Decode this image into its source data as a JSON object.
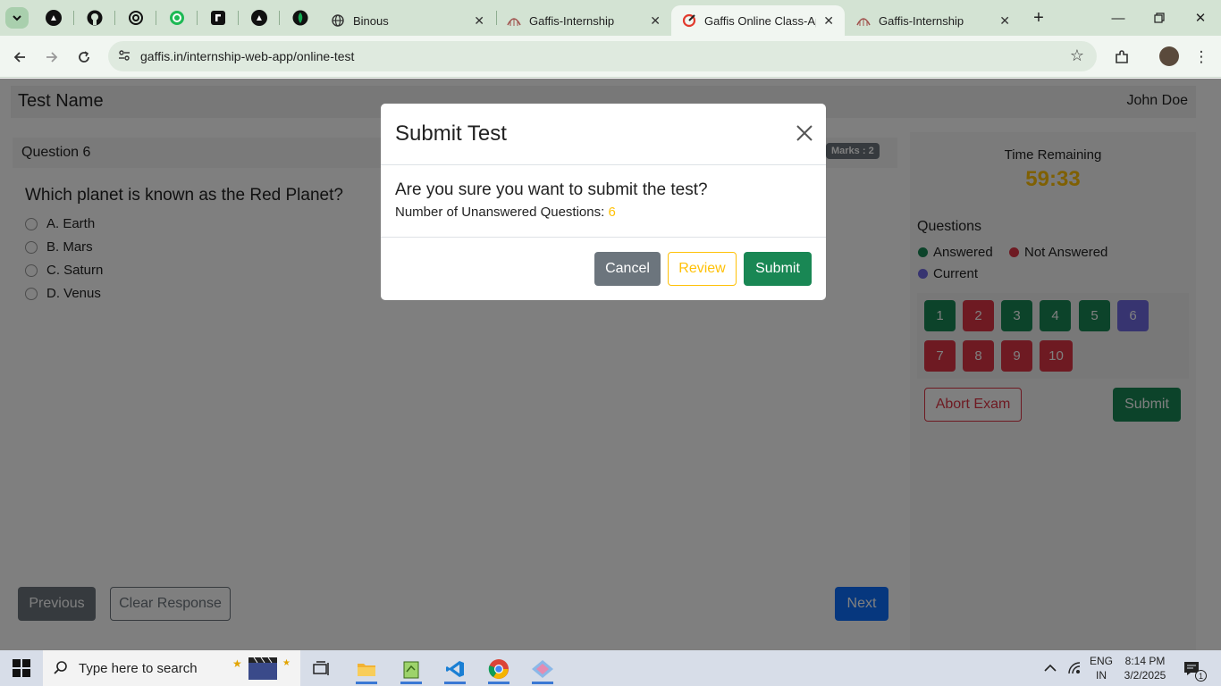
{
  "browser": {
    "tabs": [
      {
        "title": "Binous",
        "icon": "globe-icon",
        "active": false
      },
      {
        "title": "Gaffis-Internship",
        "icon": "gaffis-logo-icon",
        "active": false
      },
      {
        "title": "Gaffis Online Class-App",
        "icon": "gaffis-app-icon",
        "active": true
      },
      {
        "title": "Gaffis-Internship",
        "icon": "gaffis-logo-icon",
        "active": false
      }
    ],
    "url": "gaffis.in/internship-web-app/online-test"
  },
  "header": {
    "test_name": "Test Name",
    "user_name": "John Doe"
  },
  "question": {
    "label": "Question 6",
    "marks": "Marks : 2",
    "text": "Which planet is known as the Red Planet?",
    "options": [
      "A. Earth",
      "B. Mars",
      "C. Saturn",
      "D. Venus"
    ]
  },
  "nav": {
    "previous": "Previous",
    "clear": "Clear Response",
    "next": "Next"
  },
  "sidebar": {
    "time_label": "Time Remaining",
    "time_value": "59:33",
    "questions_label": "Questions",
    "legend": {
      "answered": "Answered",
      "not_answered": "Not Answered",
      "current": "Current"
    },
    "question_buttons": [
      {
        "n": "1",
        "status": "answered"
      },
      {
        "n": "2",
        "status": "not-answered"
      },
      {
        "n": "3",
        "status": "answered"
      },
      {
        "n": "4",
        "status": "answered"
      },
      {
        "n": "5",
        "status": "answered"
      },
      {
        "n": "6",
        "status": "current"
      },
      {
        "n": "7",
        "status": "not-answered"
      },
      {
        "n": "8",
        "status": "not-answered"
      },
      {
        "n": "9",
        "status": "not-answered"
      },
      {
        "n": "10",
        "status": "not-answered"
      }
    ],
    "abort": "Abort Exam",
    "submit": "Submit"
  },
  "modal": {
    "title": "Submit Test",
    "question": "Are you sure you want to submit the test?",
    "unanswered_label": "Number of Unanswered Questions:",
    "unanswered_count": "6",
    "cancel": "Cancel",
    "review": "Review",
    "submit": "Submit"
  },
  "taskbar": {
    "search_placeholder": "Type here to search",
    "language": "ENG",
    "region": "IN",
    "time": "8:14 PM",
    "date": "3/2/2025",
    "notifications": "1"
  },
  "colors": {
    "answered": "#198754",
    "not_answered": "#dc3545",
    "current": "#6f69e0",
    "warning": "#ffc107"
  }
}
